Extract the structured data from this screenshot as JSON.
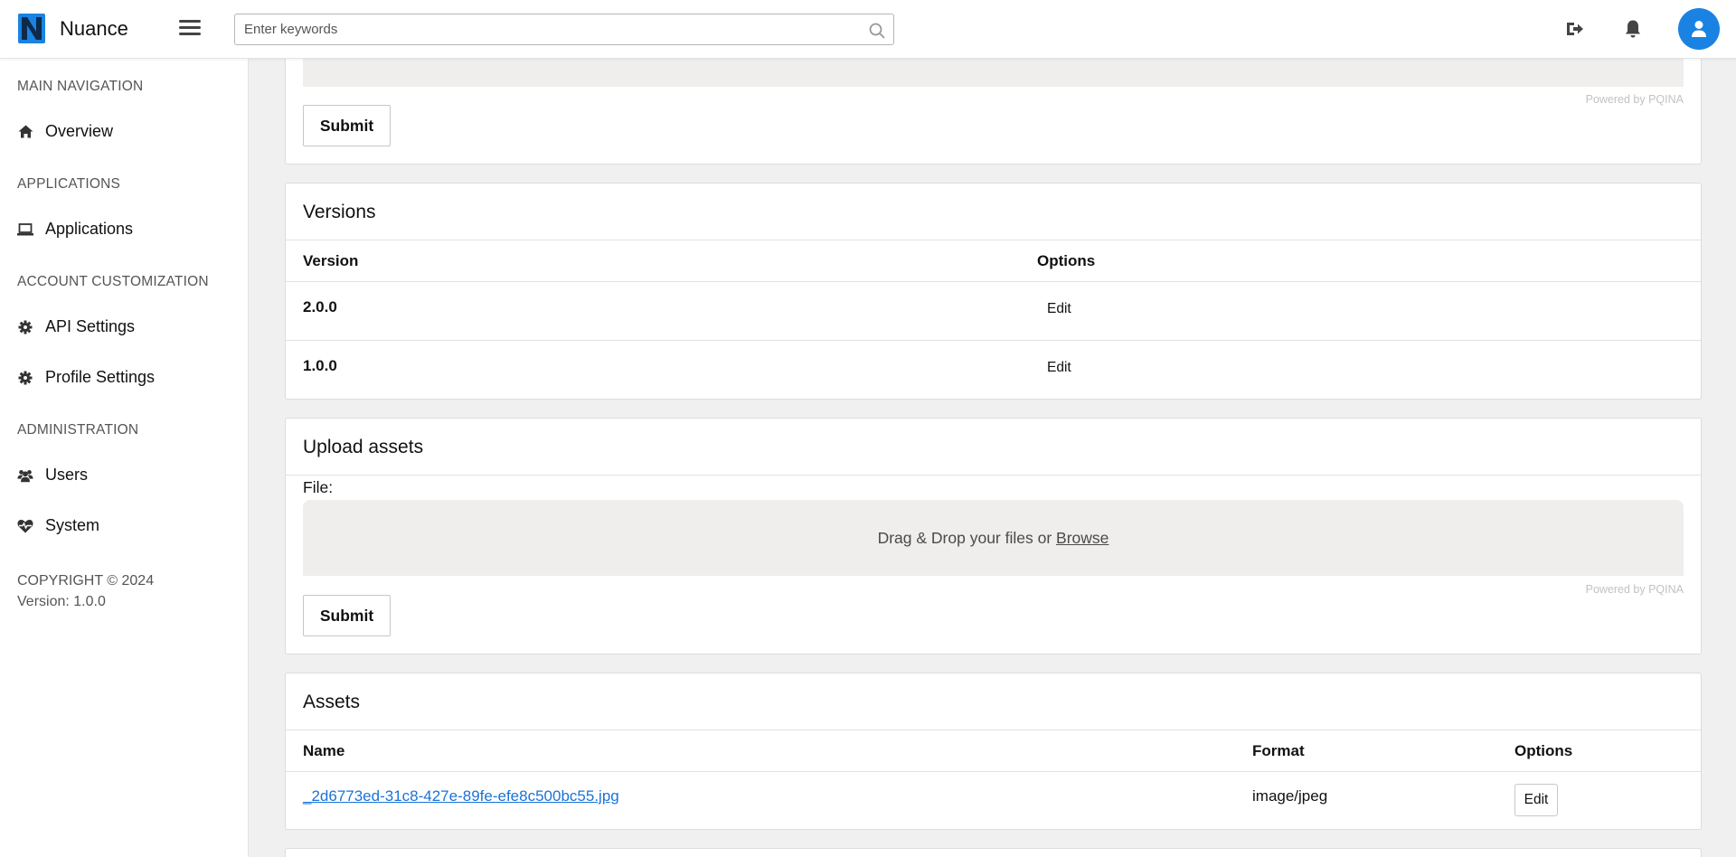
{
  "header": {
    "brand": "Nuance",
    "search_placeholder": "Enter keywords",
    "icons": [
      "menu-icon",
      "search-icon",
      "logout-icon",
      "bell-icon",
      "user-icon"
    ],
    "accent_color": "#1a82e2"
  },
  "sidebar": {
    "sections": [
      {
        "title": "MAIN NAVIGATION",
        "items": [
          {
            "label": "Overview",
            "icon": "home-icon"
          }
        ]
      },
      {
        "title": "APPLICATIONS",
        "items": [
          {
            "label": "Applications",
            "icon": "laptop-icon"
          }
        ]
      },
      {
        "title": "ACCOUNT CUSTOMIZATION",
        "items": [
          {
            "label": "API Settings",
            "icon": "gear-icon"
          },
          {
            "label": "Profile Settings",
            "icon": "gear-icon"
          }
        ]
      },
      {
        "title": "ADMINISTRATION",
        "items": [
          {
            "label": "Users",
            "icon": "users-icon"
          },
          {
            "label": "System",
            "icon": "heartbeat-icon"
          }
        ]
      }
    ],
    "copyright": "COPYRIGHT © 2024",
    "version": "Version: 1.0.0"
  },
  "top_card": {
    "submit_label": "Submit",
    "powered_by": "Powered by PQINA"
  },
  "versions": {
    "title": "Versions",
    "columns": [
      "Version",
      "Options"
    ],
    "rows": [
      {
        "version": "2.0.0",
        "action": "Edit"
      },
      {
        "version": "1.0.0",
        "action": "Edit"
      }
    ]
  },
  "upload_assets": {
    "title": "Upload assets",
    "file_label": "File:",
    "drop_text": "Drag & Drop your files or",
    "browse_label": "Browse",
    "powered_by": "Powered by PQINA",
    "submit_label": "Submit"
  },
  "assets": {
    "title": "Assets",
    "columns": [
      "Name",
      "Format",
      "Options"
    ],
    "rows": [
      {
        "name": "_2d6773ed-31c8-427e-89fe-efe8c500bc55.jpg",
        "format": "image/jpeg",
        "action": "Edit"
      }
    ]
  }
}
